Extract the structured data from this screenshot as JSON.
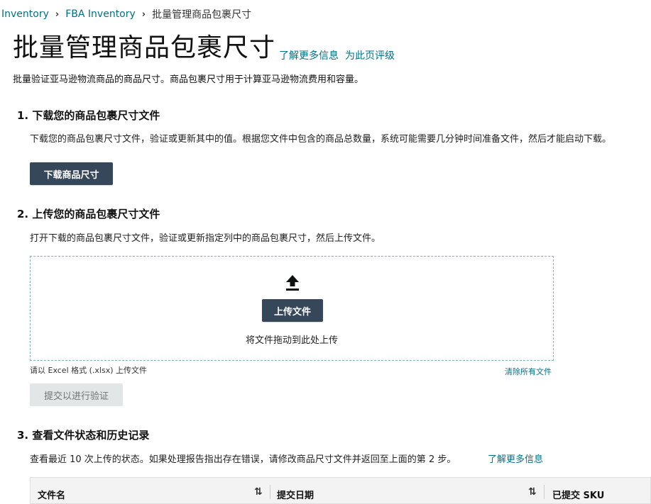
{
  "breadcrumb": {
    "items": [
      "Inventory",
      "FBA Inventory"
    ],
    "current": "批量管理商品包裹尺寸"
  },
  "header": {
    "title": "批量管理商品包裹尺寸",
    "learn_more": "了解更多信息",
    "rate_page": "为此页评级",
    "description": "批量验证亚马逊物流商品的商品尺寸。商品包裹尺寸用于计算亚马逊物流费用和容量。"
  },
  "step1": {
    "heading": "1. 下载您的商品包裹尺寸文件",
    "text": "下载您的商品包裹尺寸文件，验证或更新其中的值。根据您文件中包含的商品总数量，系统可能需要几分钟时间准备文件，然后才能启动下载。",
    "button": "下载商品尺寸"
  },
  "step2": {
    "heading": "2. 上传您的商品包裹尺寸文件",
    "text": "打开下载的商品包裹尺寸文件，验证或更新指定列中的商品包裹尺寸，然后上传文件。",
    "upload_icon": "upload-icon",
    "upload_button": "上传文件",
    "drag_text": "将文件拖动到此处上传",
    "format_note": "请以 Excel 格式 (.xlsx) 上传文件",
    "clear_all": "清除所有文件",
    "submit_button": "提交以进行验证"
  },
  "step3": {
    "heading": "3. 查看文件状态和历史记录",
    "text": "查看最近 10 次上传的状态。如果处理报告指出存在错误，请修改商品尺寸文件并返回至上面的第 2 步。",
    "learn_more": "了解更多信息",
    "table": {
      "columns": [
        "文件名",
        "提交日期",
        "已提交 SKU"
      ]
    }
  },
  "colors": {
    "link": "#007185",
    "button_dark": "#37475a",
    "button_disabled": "#e3e6e6",
    "dropzone_border": "#7fb6b6"
  }
}
